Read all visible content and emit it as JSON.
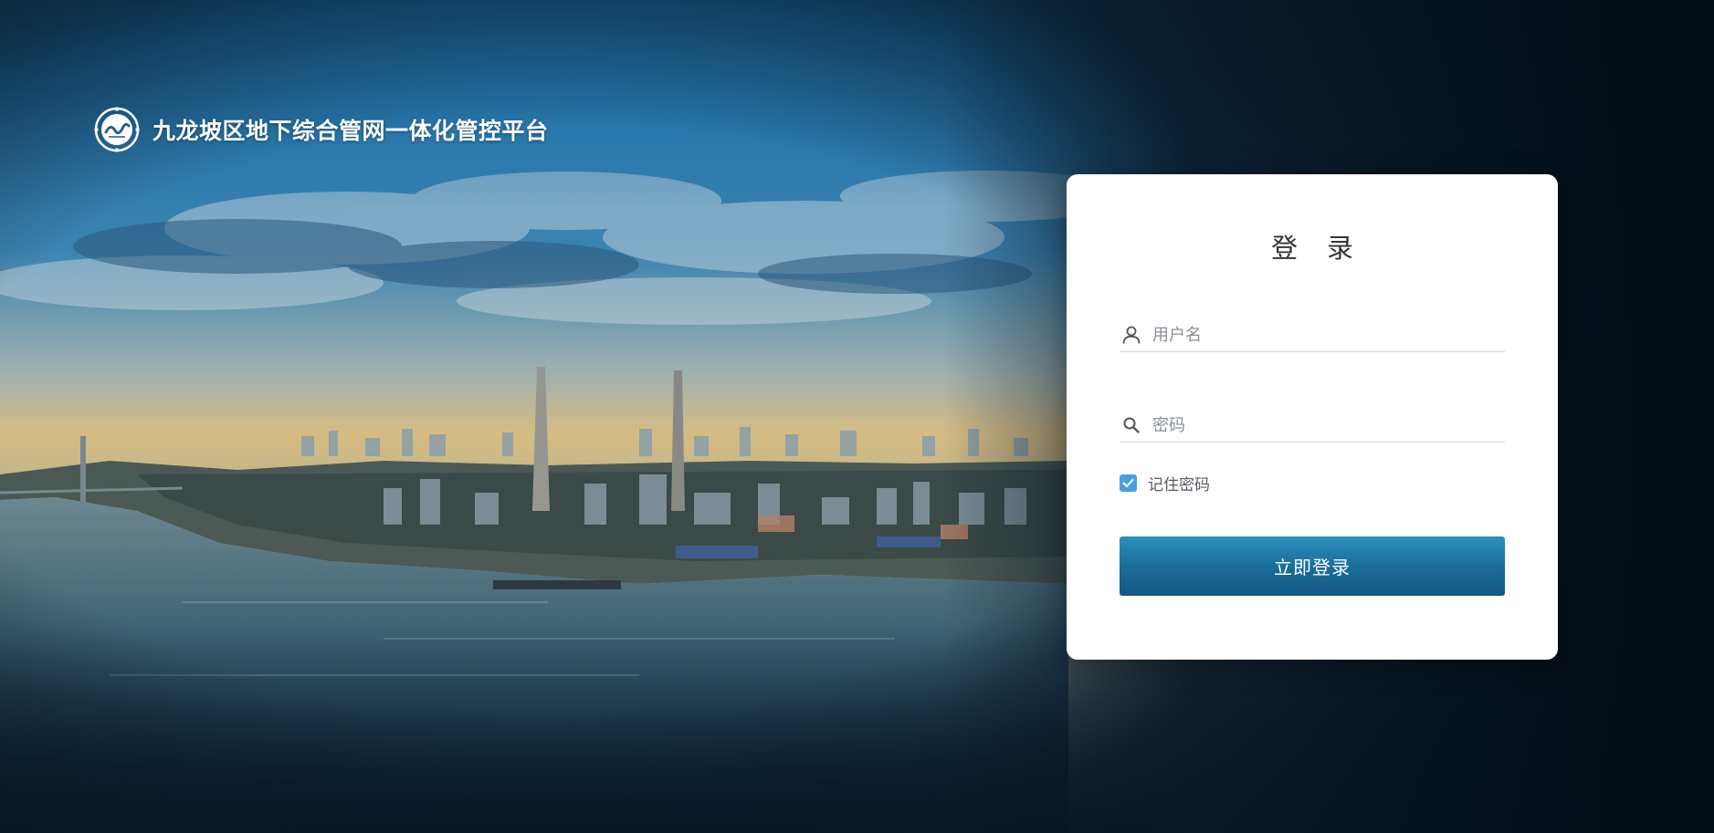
{
  "header": {
    "title": "九龙坡区地下综合管网一体化管控平台",
    "logo_icon": "district-emblem-icon"
  },
  "login": {
    "title": "登录",
    "username": {
      "value": "",
      "placeholder": "用户名",
      "icon": "user-icon"
    },
    "password": {
      "value": "",
      "placeholder": "密码",
      "icon": "search-icon"
    },
    "remember": {
      "label": "记住密码",
      "checked": true
    },
    "submit_label": "立即登录"
  },
  "colors": {
    "accent": "#1a6b98",
    "checkbox": "#4a9fe3",
    "background_dark": "#06131f"
  }
}
